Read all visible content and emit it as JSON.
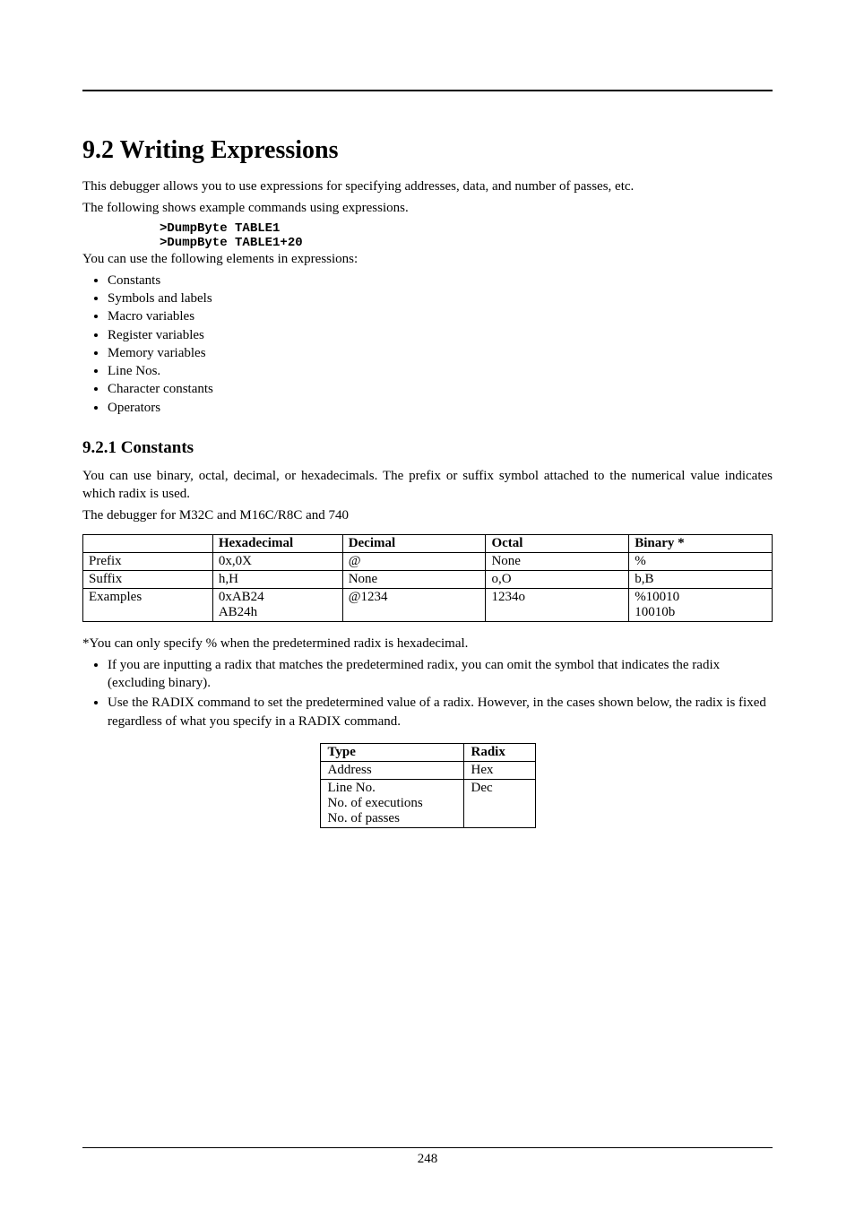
{
  "section": {
    "number": "9.2",
    "title": "Writing Expressions",
    "intro1": "This debugger allows you to use expressions for specifying addresses, data, and number of passes, etc.",
    "intro2": "The following shows example commands using expressions.",
    "cmd1": ">DumpByte TABLE1",
    "cmd2": ">DumpByte TABLE1+20",
    "intro3": "You can use the following elements in expressions:",
    "bullets": [
      "Constants",
      "Symbols and labels",
      "Macro variables",
      "Register variables",
      "Memory variables",
      "Line Nos.",
      "Character constants",
      "Operators"
    ]
  },
  "subsection": {
    "number": "9.2.1",
    "title": "Constants",
    "para1": "You can use binary, octal, decimal, or hexadecimals. The prefix or suffix symbol attached to the numerical value indicates which radix is used.",
    "para2": "The debugger for M32C and M16C/R8C and 740"
  },
  "chart_data": [
    {
      "type": "table",
      "title": "Radix prefixes/suffixes",
      "columns": [
        "",
        "Hexadecimal",
        "Decimal",
        "Octal",
        "Binary *"
      ],
      "rows": [
        {
          "label": "Prefix",
          "cells": [
            "0x,0X",
            "@",
            "None",
            "%"
          ]
        },
        {
          "label": "Suffix",
          "cells": [
            "h,H",
            "None",
            "o,O",
            "b,B"
          ]
        },
        {
          "label": "Examples",
          "cells": [
            "0xAB24\nAB24h",
            "@1234",
            "1234o",
            "%10010\n10010b"
          ]
        }
      ]
    },
    {
      "type": "table",
      "title": "Fixed radix by type",
      "columns": [
        "Type",
        "Radix"
      ],
      "rows": [
        {
          "cells": [
            "Address",
            "Hex"
          ]
        },
        {
          "cells": [
            "Line No.\nNo. of executions\nNo. of passes",
            "Dec"
          ]
        }
      ]
    }
  ],
  "footnote": "*You can only specify % when the predetermined radix is hexadecimal.",
  "notes": [
    "If you are inputting a radix that matches the predetermined radix, you can omit the symbol that indicates the radix (excluding binary).",
    "Use the RADIX command to set the predetermined value of a radix. However, in the cases shown below, the radix is fixed regardless of what you specify in a RADIX command."
  ],
  "page_number": "248"
}
